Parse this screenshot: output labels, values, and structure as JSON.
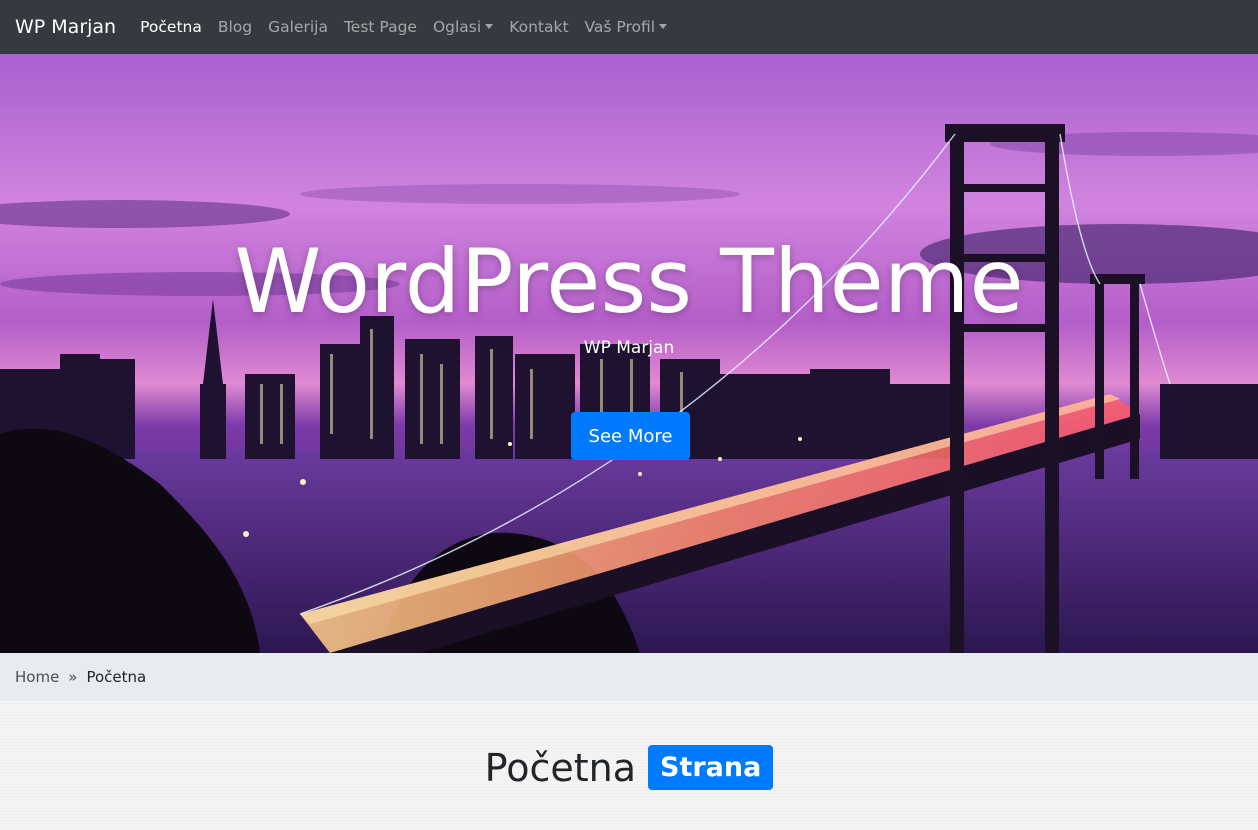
{
  "navbar": {
    "brand": "WP Marjan",
    "items": [
      {
        "label": "Početna",
        "active": true,
        "dropdown": false
      },
      {
        "label": "Blog",
        "active": false,
        "dropdown": false
      },
      {
        "label": "Galerija",
        "active": false,
        "dropdown": false
      },
      {
        "label": "Test Page",
        "active": false,
        "dropdown": false
      },
      {
        "label": "Oglasi",
        "active": false,
        "dropdown": true
      },
      {
        "label": "Kontakt",
        "active": false,
        "dropdown": false
      },
      {
        "label": "Vaš Profil",
        "active": false,
        "dropdown": true
      }
    ],
    "background_color": "#343a40"
  },
  "hero": {
    "title": "WordPress Theme",
    "subtitle": "WP Marjan",
    "button_label": "See More",
    "button_color": "#007bff"
  },
  "breadcrumb": {
    "home": "Home",
    "separator": "»",
    "current": "Početna"
  },
  "main": {
    "heading": "Početna",
    "badge": "Strana",
    "badge_color": "#007bff"
  }
}
